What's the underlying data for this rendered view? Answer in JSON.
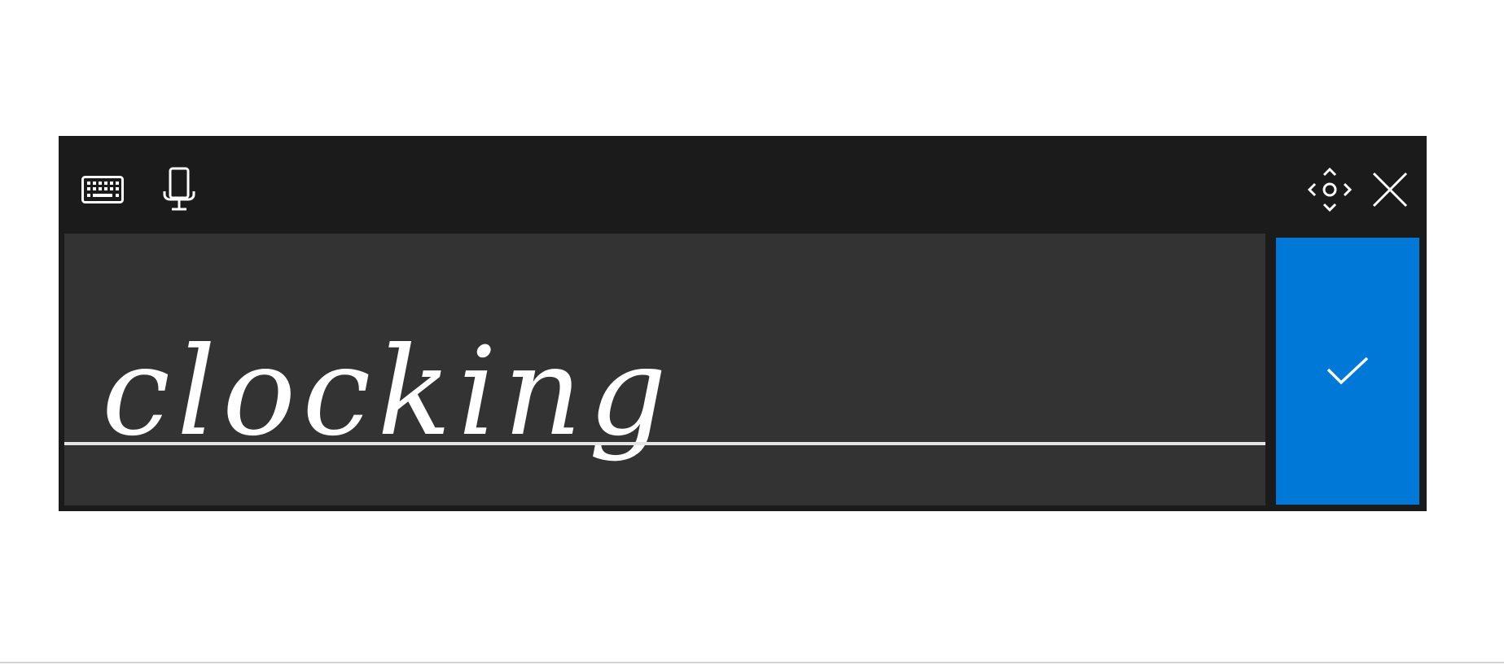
{
  "window": {
    "title": "",
    "colors": {
      "toolbar_bg": "#1b1b1b",
      "writing_area_bg": "#333333",
      "ink": "#ffffff",
      "baseline": "#e6e6e6",
      "accent": "#0078d7"
    }
  },
  "toolbar": {
    "keyboard_icon": "keyboard-icon",
    "microphone_icon": "microphone-icon",
    "move_icon": "move-icon",
    "close_icon": "close-icon"
  },
  "writing_area": {
    "handwritten_text": "clocking"
  },
  "insert_button": {
    "icon": "checkmark-icon"
  }
}
